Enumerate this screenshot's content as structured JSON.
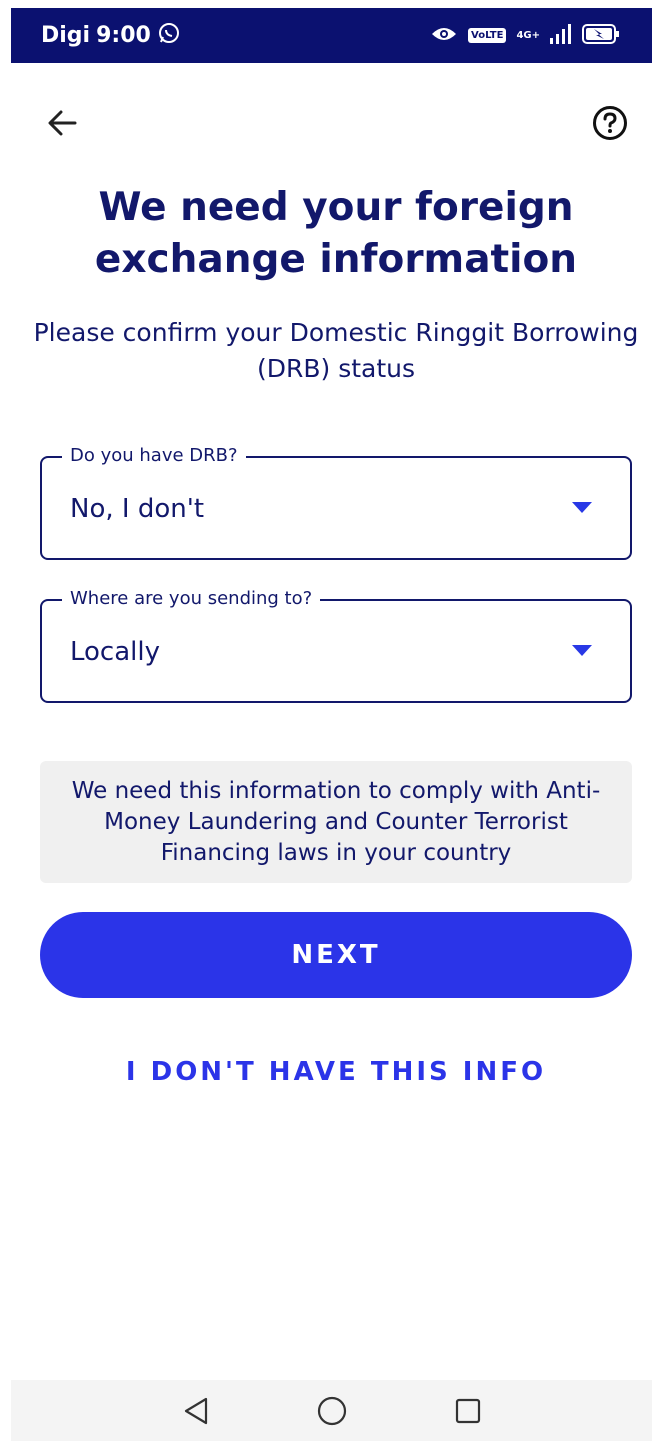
{
  "status_bar": {
    "carrier": "Digi",
    "time": "9:00",
    "volte": "VoLTE",
    "network": "4G+",
    "icons": [
      "whatsapp-icon",
      "eye-icon",
      "volte-icon",
      "signal-icon",
      "battery-charging-icon"
    ]
  },
  "nav": {
    "back_icon": "arrow-left-icon",
    "help_icon": "question-circle-icon"
  },
  "title": "We need your foreign exchange information",
  "subtitle": "Please confirm your Domestic Ringgit Borrowing (DRB) status",
  "drb_field": {
    "label": "Do you have DRB?",
    "value": "No, I don't"
  },
  "destination_field": {
    "label": "Where are you sending to?",
    "value": "Locally"
  },
  "info_text": "We need this information to comply with Anti-Money Laundering and Counter Terrorist Financing laws in your country",
  "next_button": "NEXT",
  "no_info_link": "I DON'T HAVE THIS INFO",
  "system_nav": {
    "icons": [
      "back-triangle-icon",
      "home-circle-icon",
      "recents-square-icon"
    ]
  },
  "colors": {
    "primary": "#2b34e8",
    "text": "#12186b",
    "status_bar": "#0b1170",
    "info_bg": "#f0f0f0"
  }
}
